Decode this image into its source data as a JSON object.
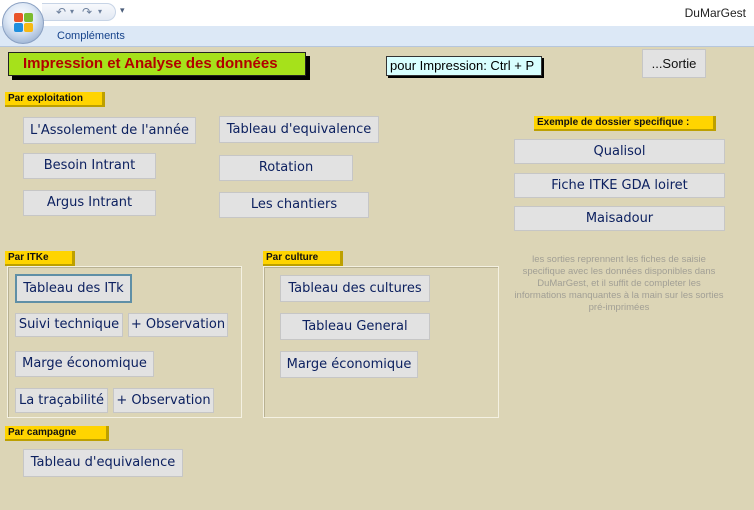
{
  "window": {
    "app_title": "DuMarGest",
    "ribbon_tab": "Compléments"
  },
  "qat": {
    "undo_icon": "↶",
    "redo_icon": "↷",
    "dropdown_icon": "▾",
    "customize_icon": "▾"
  },
  "header": {
    "title": "Impression et Analyse des données",
    "print_hint": "pour Impression:  Ctrl + P",
    "exit_label": "...Sortie"
  },
  "exploitation": {
    "label": "Par exploitation",
    "assolement": "L'Assolement de l'année",
    "besoin": "Besoin Intrant",
    "argus": "Argus Intrant",
    "equivalence": "Tableau d'equivalence",
    "rotation": "Rotation",
    "chantiers": "Les chantiers"
  },
  "specific": {
    "label": "Exemple de dossier specifique :",
    "qualisol": "Qualisol",
    "itke_gda": "Fiche ITKE GDA loiret",
    "maisadour": "Maisadour",
    "info": "les sorties reprennent les fiches de saisie specifique avec les données disponibles dans DuMarGest, et il suffit de completer les informations manquantes à la main sur les sorties pré-imprimées"
  },
  "itke": {
    "label": "Par ITKe",
    "tableau_itk": "Tableau des ITk",
    "suivi": "Suivi technique",
    "observation_1": "+ Observation",
    "marge": "Marge économique",
    "tracabilite": "La traçabilité",
    "observation_2": "+ Observation"
  },
  "culture": {
    "label": "Par culture",
    "tableau_cultures": "Tableau des cultures",
    "tableau_general": "Tableau General",
    "marge": "Marge économique"
  },
  "campagne": {
    "label": "Par campagne",
    "equivalence": "Tableau d'equivalence"
  }
}
